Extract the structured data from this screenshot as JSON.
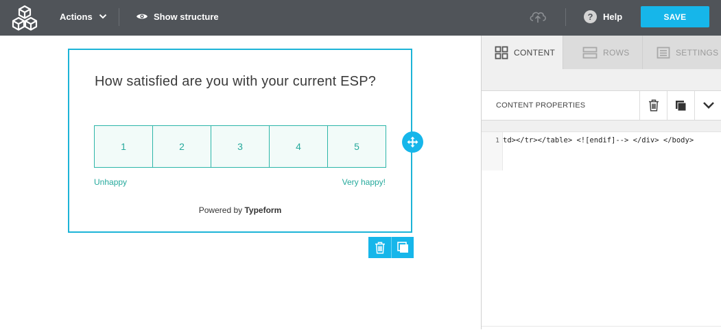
{
  "topbar": {
    "actions_label": "Actions",
    "show_structure_label": "Show structure",
    "help_label": "Help",
    "help_glyph": "?",
    "save_label": "SAVE",
    "icons": [
      "logo-cubes-icon",
      "chevron-down-icon",
      "eye-icon",
      "cloud-upload-icon",
      "help-icon"
    ]
  },
  "canvas": {
    "question": "How satisfied are you with your current ESP?",
    "scale": [
      "1",
      "2",
      "3",
      "4",
      "5"
    ],
    "label_low": "Unhappy",
    "label_high": "Very happy!",
    "powered_prefix": "Powered by ",
    "powered_brand": "Typeform",
    "icons": [
      "move-icon",
      "trash-icon",
      "duplicate-icon"
    ]
  },
  "panel": {
    "tabs": [
      {
        "label": "CONTENT",
        "icon": "grid-icon",
        "active": true
      },
      {
        "label": "ROWS",
        "icon": "rows-icon",
        "active": false
      },
      {
        "label": "SETTINGS",
        "icon": "settings-list-icon",
        "active": false
      }
    ],
    "properties_title": "CONTENT PROPERTIES",
    "editor": {
      "line_number": "1",
      "code": "td></tr></table> <![endif]--> </div> </body>"
    }
  },
  "colors": {
    "topbar": "#505459",
    "accent": "#16b6ea",
    "block_border": "#1bb3d7",
    "scale_teal": "#25a99c",
    "panel_bg": "#f0f0f0"
  }
}
